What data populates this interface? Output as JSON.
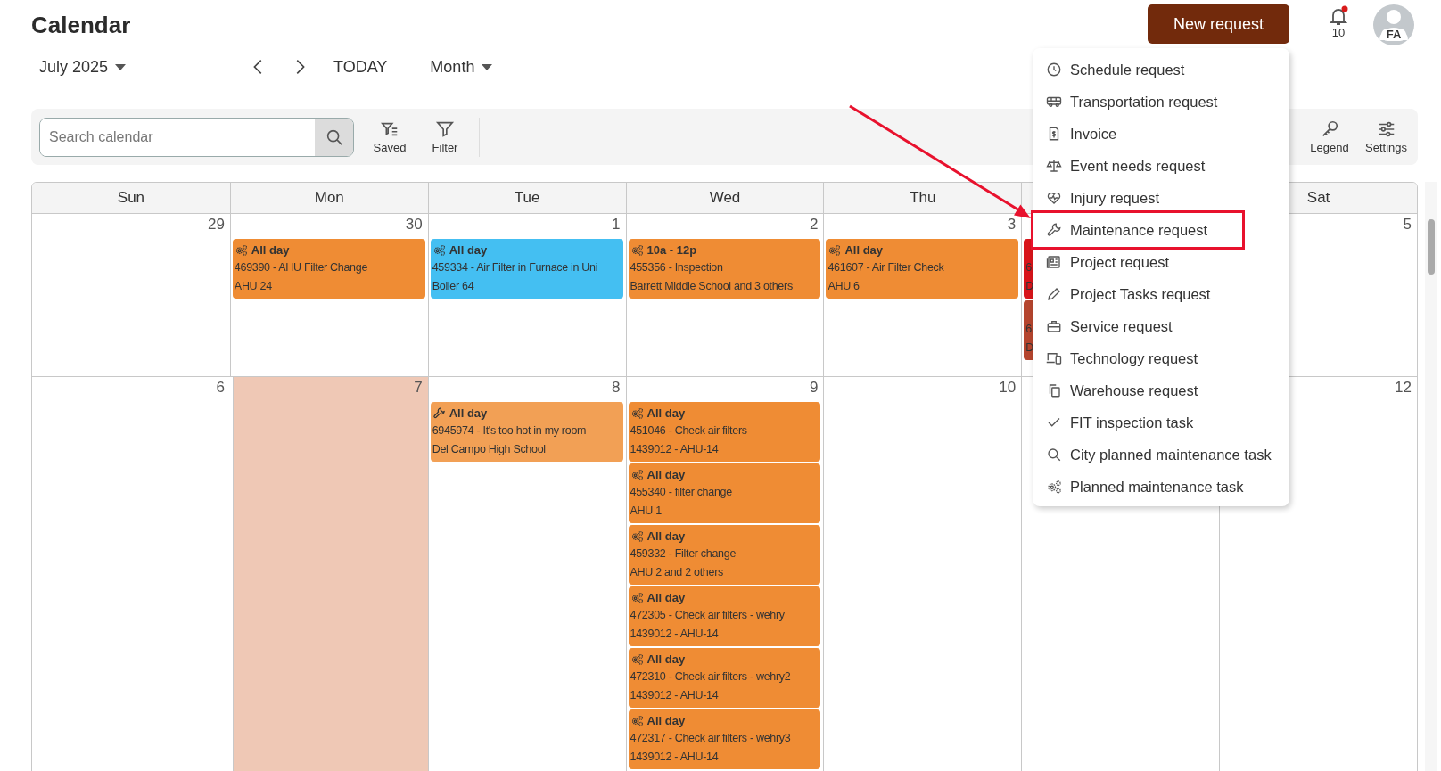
{
  "page_title": "Calendar",
  "header": {
    "new_request": "New request",
    "notifications": {
      "count": "10",
      "unread": true
    },
    "avatar": {
      "initials": "FA"
    }
  },
  "nav": {
    "period": "July 2025",
    "today": "TODAY",
    "view": "Month"
  },
  "toolbar": {
    "search": {
      "placeholder": "Search calendar"
    },
    "tools_left": [
      {
        "kind": "saved",
        "label": "Saved"
      },
      {
        "kind": "filter",
        "label": "Filter"
      }
    ],
    "tools_right": [
      {
        "kind": "key",
        "label": "Legend"
      },
      {
        "kind": "sliders",
        "label": "Settings"
      }
    ]
  },
  "calendar": {
    "weekdays": {
      "sun": "Sun",
      "mon": "Mon",
      "tue": "Tue",
      "wed": "Wed",
      "thu": "Thu",
      "sat": "Sat"
    },
    "weeks": [
      {
        "days": [
          {
            "date": "29",
            "today": false
          },
          {
            "date": "30",
            "today": false,
            "events": [
              {
                "kind": "gears",
                "color": "#ef8c34",
                "time": "All day",
                "title": "469390 - AHU Filter Change",
                "location": "AHU 24"
              }
            ]
          },
          {
            "date": "1",
            "today": false,
            "events": [
              {
                "kind": "gears",
                "color": "#44bff2",
                "time": "All day",
                "title": "459334 - Air Filter in Furnace in Uni",
                "location": "Boiler 64"
              }
            ]
          },
          {
            "date": "2",
            "today": false,
            "events": [
              {
                "kind": "gears",
                "color": "#ef8c34",
                "time": "10a - 12p",
                "title": "455356 - Inspection",
                "location": "Barrett Middle School and 3 others"
              }
            ]
          },
          {
            "date": "3",
            "today": false,
            "events": [
              {
                "kind": "gears",
                "color": "#ef8c34",
                "time": "All day",
                "title": "461607 - Air Filter Check",
                "location": "AHU 6"
              }
            ]
          },
          {
            "today": false,
            "events": [
              {
                "color": "#d8141a",
                "title": "6",
                "location": "D"
              },
              {
                "color": "#b5452e",
                "title": "6",
                "location": "D"
              }
            ]
          },
          {
            "date": "5",
            "today": false
          }
        ]
      },
      {
        "days": [
          {
            "date": "6",
            "today": false
          },
          {
            "date": "7",
            "today": true
          },
          {
            "date": "8",
            "today": false,
            "events": [
              {
                "kind": "wrench",
                "color": "#f2a055",
                "time": "All day",
                "title": "6945974 - It's too hot in my room",
                "location": "Del Campo High School"
              }
            ]
          },
          {
            "date": "9",
            "today": false,
            "events": [
              {
                "kind": "gears",
                "color": "#ef8c34",
                "time": "All day",
                "title": "451046 - Check air filters",
                "location": "1439012 - AHU-14"
              },
              {
                "kind": "gears",
                "color": "#ef8c34",
                "time": "All day",
                "title": "455340 - filter change",
                "location": "AHU 1"
              },
              {
                "kind": "gears",
                "color": "#ef8c34",
                "time": "All day",
                "title": "459332 - Filter change",
                "location": "AHU 2 and 2 others"
              },
              {
                "kind": "gears",
                "color": "#ef8c34",
                "time": "All day",
                "title": "472305 - Check air filters - wehry",
                "location": "1439012 - AHU-14"
              },
              {
                "kind": "gears",
                "color": "#ef8c34",
                "time": "All day",
                "title": "472310 - Check air filters - wehry2",
                "location": "1439012 - AHU-14"
              },
              {
                "kind": "gears",
                "color": "#ef8c34",
                "time": "All day",
                "title": "472317 - Check air filters - wehry3",
                "location": "1439012 - AHU-14"
              }
            ]
          },
          {
            "date": "10",
            "today": false
          },
          {
            "today": false
          },
          {
            "date": "12",
            "today": false
          }
        ]
      }
    ]
  },
  "new_request_menu": {
    "items": [
      {
        "kind": "clock",
        "label": "Schedule request",
        "highlighted": false
      },
      {
        "kind": "bus",
        "label": "Transportation request",
        "highlighted": false
      },
      {
        "kind": "invoice",
        "label": "Invoice",
        "highlighted": false
      },
      {
        "kind": "scale",
        "label": "Event needs request",
        "highlighted": false
      },
      {
        "kind": "heart",
        "label": "Injury request",
        "highlighted": false
      },
      {
        "kind": "wrench",
        "label": "Maintenance request",
        "highlighted": true
      },
      {
        "kind": "news",
        "label": "Project request",
        "highlighted": false
      },
      {
        "kind": "pencil",
        "label": "Project Tasks request",
        "highlighted": false
      },
      {
        "kind": "briefcase",
        "label": "Service request",
        "highlighted": false
      },
      {
        "kind": "devices",
        "label": "Technology request",
        "highlighted": false
      },
      {
        "kind": "copy",
        "label": "Warehouse request",
        "highlighted": false
      },
      {
        "kind": "check",
        "label": "FIT inspection task",
        "highlighted": false
      },
      {
        "kind": "search",
        "label": "City planned maintenance task",
        "highlighted": false
      },
      {
        "kind": "gears",
        "label": "Planned maintenance task",
        "highlighted": false
      }
    ]
  }
}
